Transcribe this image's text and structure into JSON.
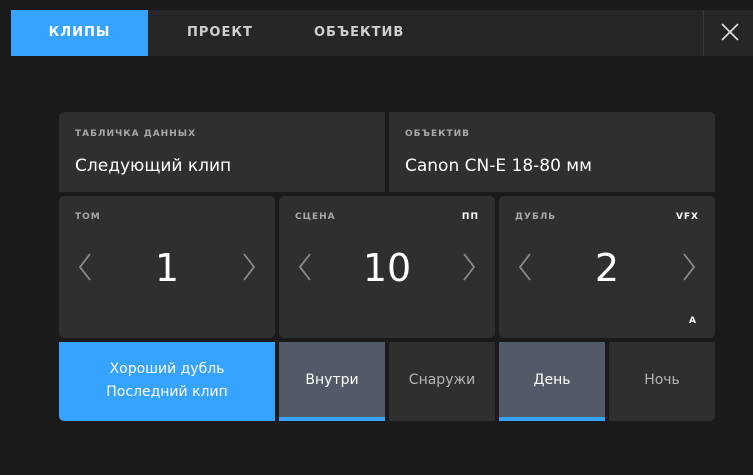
{
  "tabs": [
    {
      "label": "КЛИПЫ",
      "active": true
    },
    {
      "label": "ПРОЕКТ",
      "active": false
    },
    {
      "label": "ОБЪЕКТИВ",
      "active": false
    }
  ],
  "close_icon": "close-icon",
  "slate": {
    "label": "ТАБЛИЧКА ДАННЫХ",
    "value": "Следующий клип"
  },
  "lens": {
    "label": "ОБЪЕКТИВ",
    "value": "Canon CN-E 18-80 мм"
  },
  "roll": {
    "label": "ТОМ",
    "value": "1"
  },
  "scene": {
    "label": "СЦЕНА",
    "value": "10",
    "flag": "ПП"
  },
  "take": {
    "label": "ДУБЛЬ",
    "value": "2",
    "flag": "VFX",
    "suffix": "A"
  },
  "good_take": {
    "line1": "Хороший дубль",
    "line2": "Последний клип"
  },
  "interior": {
    "label": "Внутри",
    "selected": true
  },
  "exterior": {
    "label": "Снаружи",
    "selected": false
  },
  "day": {
    "label": "День",
    "selected": true
  },
  "night": {
    "label": "Ночь",
    "selected": false
  },
  "colors": {
    "accent": "#35a3ff",
    "panel": "#2f2f2f",
    "selected": "#535a67",
    "background": "#1a1a1a"
  }
}
